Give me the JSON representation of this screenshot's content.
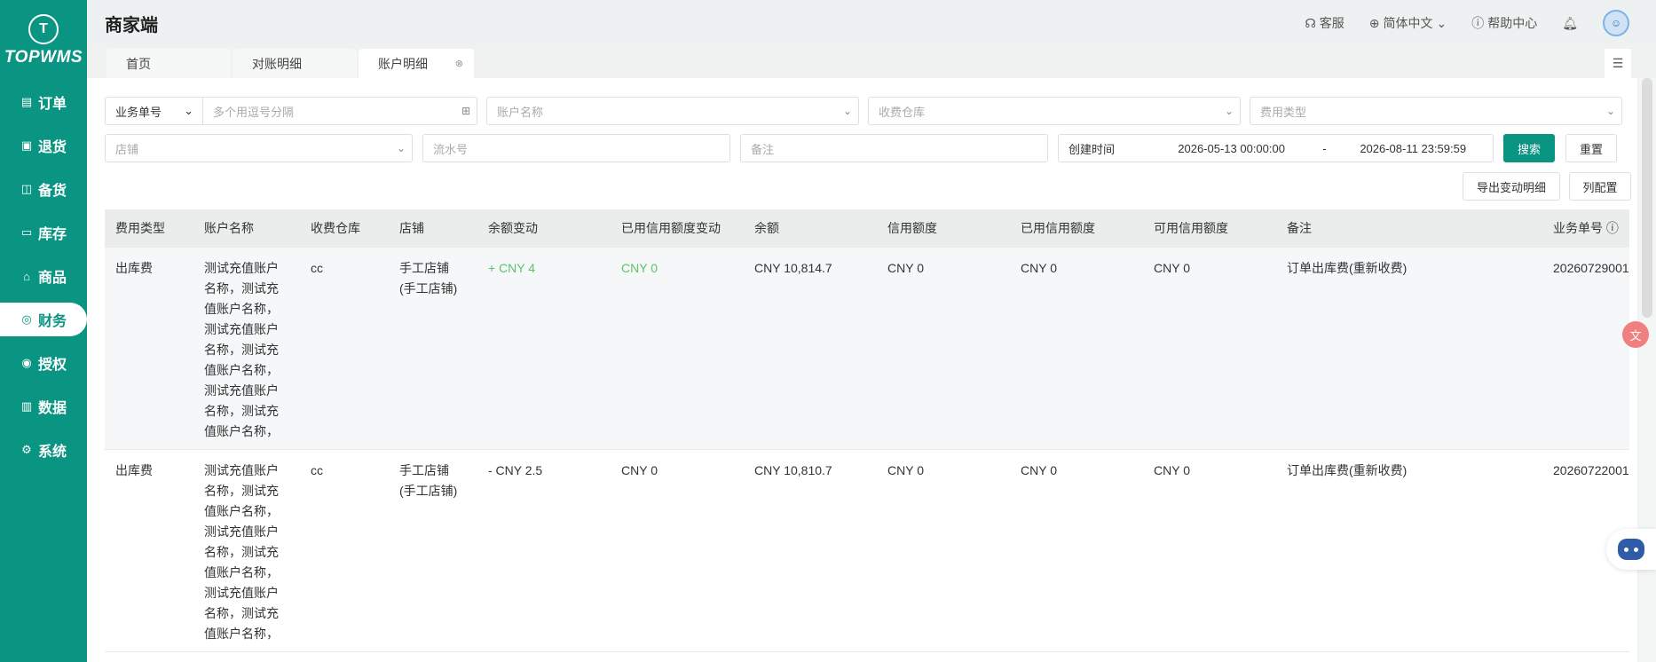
{
  "brand": {
    "logo_text": "TOPWMS",
    "mark": "T"
  },
  "sidebar": {
    "items": [
      {
        "label": "订单",
        "icon": "order-icon"
      },
      {
        "label": "退货",
        "icon": "return-icon"
      },
      {
        "label": "备货",
        "icon": "stock-prep-icon"
      },
      {
        "label": "库存",
        "icon": "inventory-icon"
      },
      {
        "label": "商品",
        "icon": "product-icon"
      },
      {
        "label": "财务",
        "icon": "finance-icon"
      },
      {
        "label": "授权",
        "icon": "auth-icon"
      },
      {
        "label": "数据",
        "icon": "data-icon"
      },
      {
        "label": "系统",
        "icon": "settings-icon"
      }
    ],
    "active_index": 5
  },
  "header": {
    "title": "商家端",
    "service": "客服",
    "language": "简体中文",
    "help": "帮助中心"
  },
  "tabs": [
    {
      "label": "首页"
    },
    {
      "label": "对账明细"
    },
    {
      "label": "账户明细"
    }
  ],
  "filters": {
    "biz_no_label": "业务单号",
    "biz_no_placeholder": "多个用逗号分隔",
    "account_placeholder": "账户名称",
    "warehouse_placeholder": "收费仓库",
    "fee_type_placeholder": "费用类型",
    "shop_placeholder": "店铺",
    "serial_placeholder": "流水号",
    "remark_placeholder": "备注",
    "created_label": "创建时间",
    "date_start": "2026-05-13 00:00:00",
    "date_sep": "-",
    "date_end": "2026-08-11 23:59:59",
    "search": "搜索",
    "reset": "重置",
    "export": "导出变动明细",
    "columns": "列配置"
  },
  "table": {
    "headers": [
      "费用类型",
      "账户名称",
      "收费仓库",
      "店铺",
      "余额变动",
      "已用信用额度变动",
      "余额",
      "信用额度",
      "已用信用额度",
      "可用信用额度",
      "备注",
      "业务单号 ⓘ"
    ],
    "rows": [
      [
        "出库费",
        "测试充值账户名称，测试充值账户名称，测试充值账户名称，测试充值账户名称，测试充值账户名称，测试充值账户名称，",
        "cc",
        "手工店铺(手工店铺)",
        "+ CNY 4",
        "CNY 0",
        "CNY 10,814.7",
        "CNY 0",
        "CNY 0",
        "CNY 0",
        "订单出库费(重新收费)",
        "20260729001"
      ],
      [
        "出库费",
        "测试充值账户名称，测试充值账户名称，测试充值账户名称，测试充值账户名称，测试充值账户名称，测试充值账户名称，",
        "cc",
        "手工店铺(手工店铺)",
        "- CNY 2.5",
        "CNY 0",
        "CNY 10,810.7",
        "CNY 0",
        "CNY 0",
        "CNY 0",
        "订单出库费(重新收费)",
        "20260722001"
      ]
    ]
  },
  "colors": {
    "brand": "#0a9482",
    "positive": "#5ec26a"
  }
}
